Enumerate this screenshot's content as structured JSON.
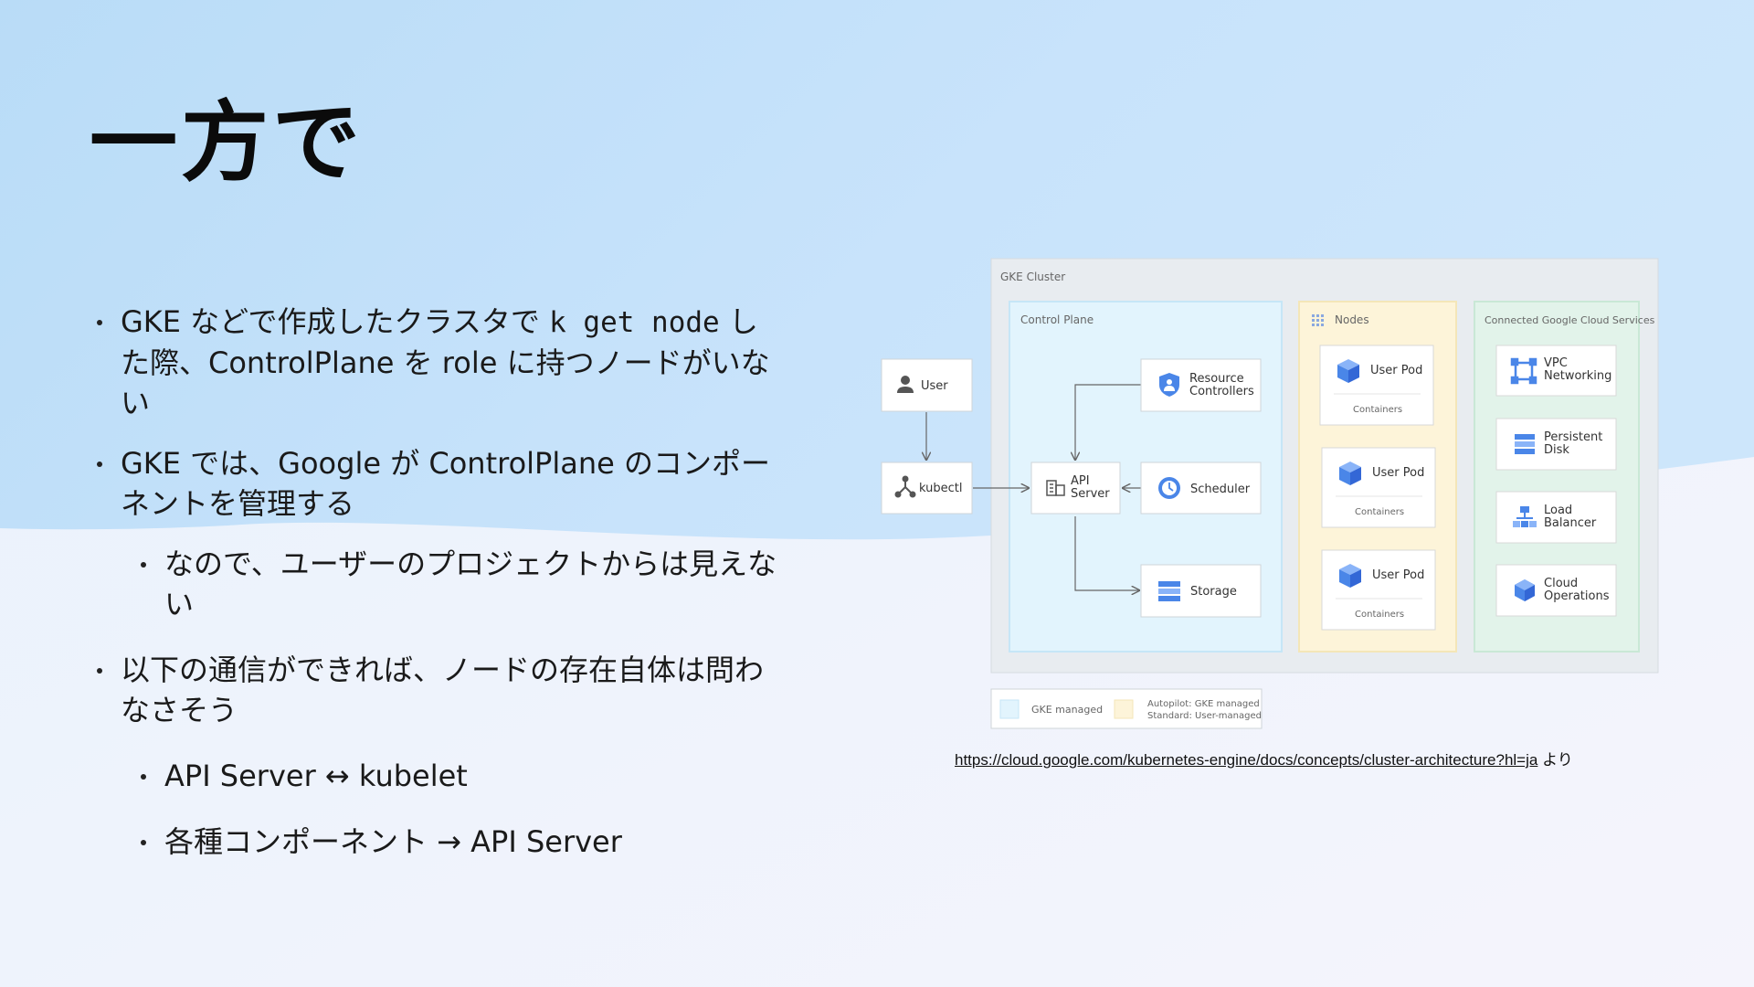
{
  "slide": {
    "title": "一方で",
    "bullets": [
      {
        "pre": "GKE などで作成したクラスタで ",
        "code": "k get node",
        "post": " した際、ControlPlane を role に持つノードがいない"
      },
      {
        "text": "GKE では、Google が ControlPlane のコンポーネントを管理する"
      },
      {
        "text": "なので、ユーザーのプロジェクトからは見えない"
      },
      {
        "text": "以下の通信ができれば、ノードの存在自体は問わなさそう"
      },
      {
        "text": "API Server ↔ kubelet"
      },
      {
        "text": "各種コンポーネント → API Server"
      }
    ]
  },
  "diagram": {
    "cluster_label": "GKE Cluster",
    "control_plane_label": "Control Plane",
    "nodes_label": "Nodes",
    "connected_label": "Connected Google Cloud Services",
    "user": "User",
    "kubectl": "kubectl",
    "api_server_1": "API",
    "api_server_2": "Server",
    "resource_controllers_1": "Resource",
    "resource_controllers_2": "Controllers",
    "scheduler": "Scheduler",
    "storage": "Storage",
    "pods": [
      {
        "label": "User Pod",
        "sub": "Containers"
      },
      {
        "label": "User Pod",
        "sub": "Containers"
      },
      {
        "label": "User Pod",
        "sub": "Containers"
      }
    ],
    "services": [
      {
        "line1": "VPC",
        "line2": "Networking"
      },
      {
        "line1": "Persistent",
        "line2": "Disk"
      },
      {
        "line1": "Load",
        "line2": "Balancer"
      },
      {
        "line1": "Cloud",
        "line2": "Operations"
      }
    ],
    "legend_gke": "GKE managed",
    "legend_autopilot_1": "Autopilot: GKE managed",
    "legend_autopilot_2": "Standard: User-managed",
    "colors": {
      "blue": "#4a86e8",
      "control_bg": "#e2f4fd",
      "nodes_bg": "#fdf4d9",
      "services_bg": "#e2f3ea",
      "cluster_bg": "#e8ecf0"
    }
  },
  "source": {
    "url": "https://cloud.google.com/kubernetes-engine/docs/concepts/cluster-architecture?hl=ja",
    "suffix": " より"
  }
}
